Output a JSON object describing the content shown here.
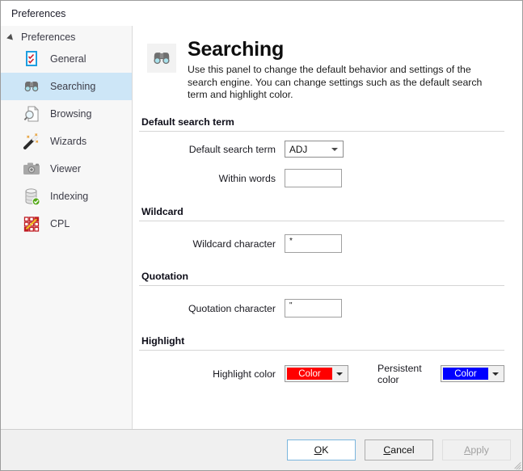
{
  "window": {
    "title": "Preferences"
  },
  "sidebar": {
    "root_label": "Preferences",
    "items": [
      {
        "label": "General",
        "icon": "checklist-icon",
        "selected": false
      },
      {
        "label": "Searching",
        "icon": "binoculars-icon",
        "selected": true
      },
      {
        "label": "Browsing",
        "icon": "document-search-icon",
        "selected": false
      },
      {
        "label": "Wizards",
        "icon": "magic-wand-icon",
        "selected": false
      },
      {
        "label": "Viewer",
        "icon": "camera-icon",
        "selected": false
      },
      {
        "label": "Indexing",
        "icon": "database-check-icon",
        "selected": false
      },
      {
        "label": "CPL",
        "icon": "cpl-grid-icon",
        "selected": false
      }
    ]
  },
  "panel": {
    "icon": "binoculars-icon",
    "title": "Searching",
    "description": "Use this panel to change the default behavior and settings of the search engine. You can change settings such as the default search term and highlight color.",
    "sections": [
      {
        "title": "Default search term",
        "fields": [
          {
            "label": "Default search term",
            "type": "combobox",
            "value": "ADJ"
          },
          {
            "label": "Within words",
            "type": "textbox",
            "value": ""
          }
        ]
      },
      {
        "title": "Wildcard",
        "fields": [
          {
            "label": "Wildcard character",
            "type": "textbox",
            "value": "*"
          }
        ]
      },
      {
        "title": "Quotation",
        "fields": [
          {
            "label": "Quotation character",
            "type": "textbox",
            "value": "\""
          }
        ]
      },
      {
        "title": "Highlight",
        "fields": [
          {
            "label": "Highlight color",
            "type": "colorbutton",
            "value": "Color",
            "color": "#FF0000"
          },
          {
            "label": "Persistent color",
            "type": "colorbutton",
            "value": "Color",
            "color": "#0000FF"
          }
        ]
      }
    ]
  },
  "footer": {
    "ok": {
      "label": "OK",
      "accel": "O",
      "state": "default"
    },
    "cancel": {
      "label": "Cancel",
      "accel": "C",
      "state": "normal"
    },
    "apply": {
      "label": "Apply",
      "accel": "A",
      "state": "disabled"
    }
  }
}
